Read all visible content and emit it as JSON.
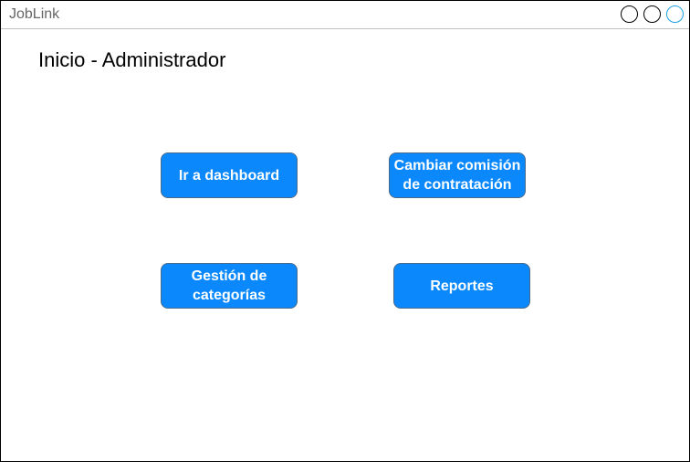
{
  "window": {
    "title": "JobLink",
    "controls": [
      "circle-button",
      "circle-button",
      "circle-button"
    ]
  },
  "page": {
    "title": "Inicio - Administrador"
  },
  "actions": {
    "dashboard_label": "Ir a dashboard",
    "commission_label": "Cambiar comisión de contratación",
    "categories_label": "Gestión de categorías",
    "reports_label": "Reportes"
  },
  "colors": {
    "button_fill": "#0a88fc",
    "button_text": "#ffffff",
    "active_control": "#1ba1e2"
  }
}
